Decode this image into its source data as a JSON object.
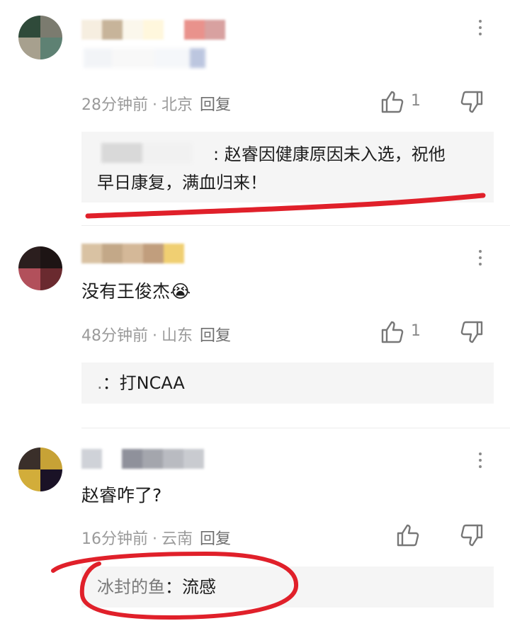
{
  "comments": [
    {
      "text": "",
      "time": "28分钟前",
      "location": "北京",
      "reply_label": "回复",
      "likes": "1",
      "reply": {
        "author": "",
        "separator": ":",
        "line1": "赵睿因健康原因未入选，祝他",
        "line2": "早日康复，满血归来！"
      }
    },
    {
      "text": "没有王俊杰😭",
      "time": "48分钟前",
      "location": "山东",
      "reply_label": "回复",
      "likes": "1",
      "reply": {
        "author": ".",
        "separator": "：",
        "text": "打NCAA"
      }
    },
    {
      "text": "赵睿咋了?",
      "time": "16分钟前",
      "location": "云南",
      "reply_label": "回复",
      "likes": "",
      "reply": {
        "author": "冰封的鱼",
        "separator": "：",
        "text": "流感"
      }
    }
  ],
  "separator_dot": "·",
  "icons": {
    "more": "more-vertical-icon",
    "like": "thumbs-up-icon",
    "dislike": "thumbs-down-icon"
  },
  "colors": {
    "annotation": "#e0202a",
    "meta_text": "#9a9a9a",
    "reply_bg": "#f5f5f5"
  }
}
